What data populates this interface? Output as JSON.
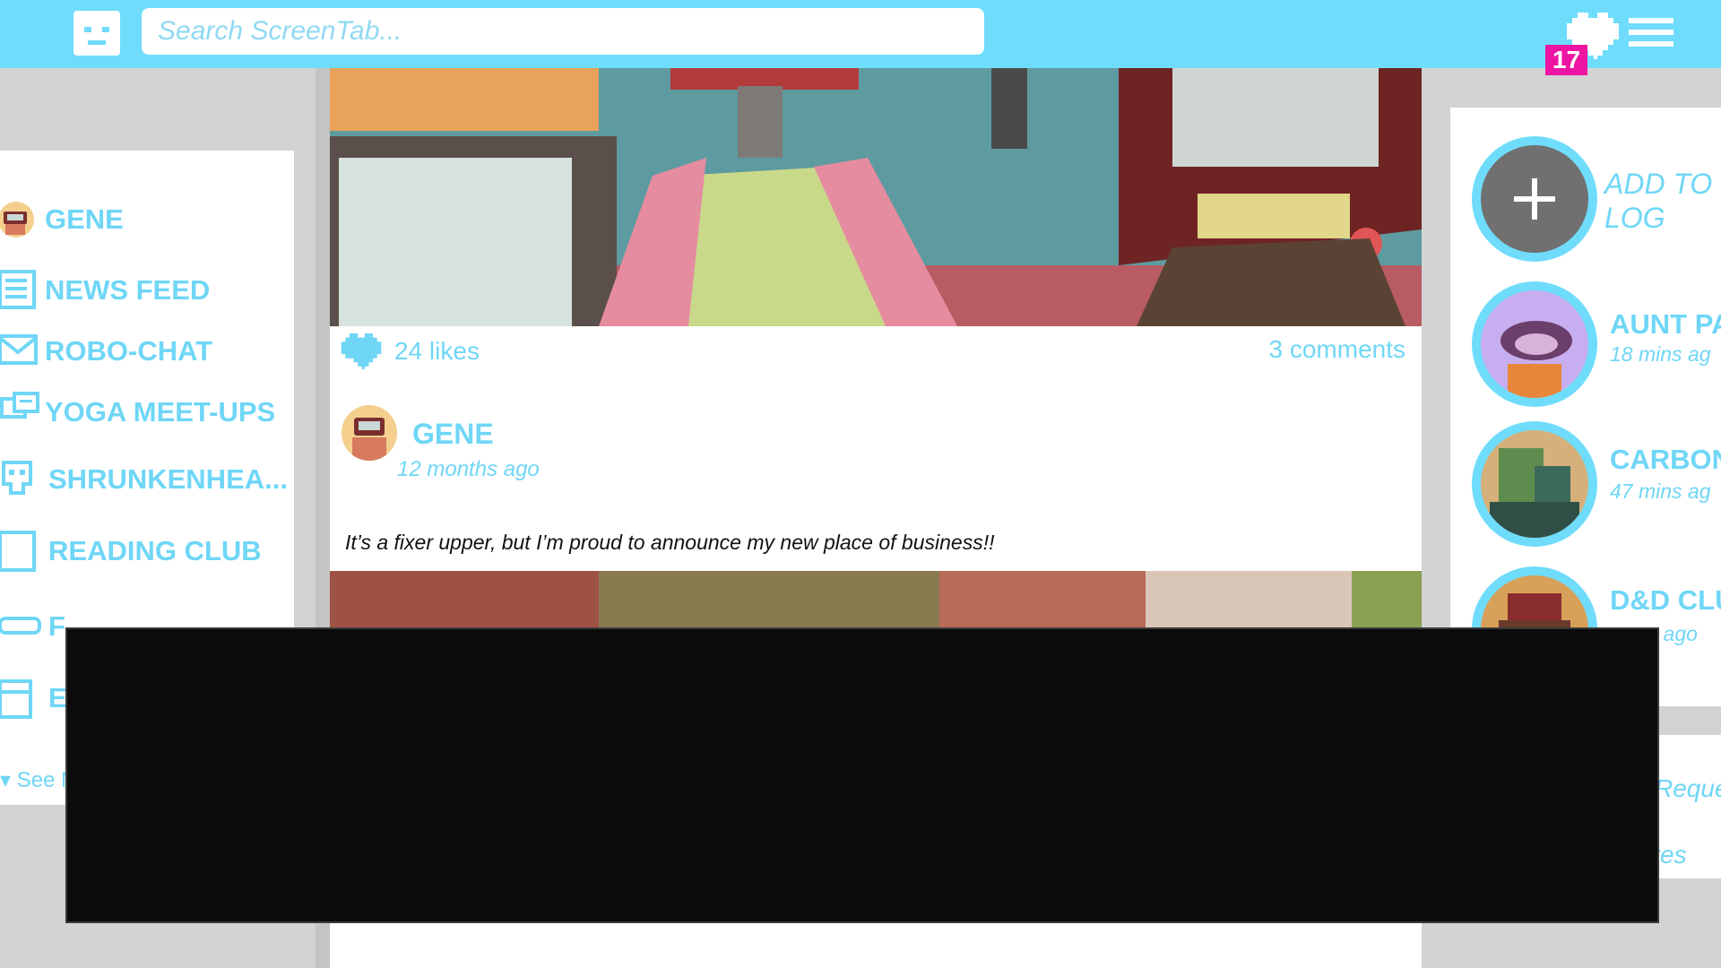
{
  "search": {
    "placeholder": "Search ScreenTab..."
  },
  "header": {
    "notification_count": "17"
  },
  "sidebar": {
    "items": [
      {
        "label": "GENE"
      },
      {
        "label": "NEWS FEED"
      },
      {
        "label": "ROBO-CHAT"
      },
      {
        "label": "YOGA MEET-UPS"
      },
      {
        "label": "SHRUNKENHEA..."
      },
      {
        "label": "READING CLUB"
      },
      {
        "label": "F"
      },
      {
        "label": "E"
      }
    ],
    "see_more": "See M"
  },
  "feed": {
    "post1": {
      "likes": "24 likes",
      "comments": "3 comments"
    },
    "post2": {
      "author": "GENE",
      "time": "12 months ago",
      "text": "It’s a fixer upper, but I’m proud to announce my new place of business!!"
    }
  },
  "right": {
    "add_label": "ADD TO LOG",
    "stories": [
      {
        "name": "AUNT PA",
        "time": "18 mins ag"
      },
      {
        "name": "CARBON",
        "time": "47 mins ag"
      },
      {
        "name": "D&D CLU",
        "time": "rs ago"
      }
    ],
    "links": [
      "Reque",
      "vites"
    ]
  },
  "colors": {
    "accent": "#6fdcfb",
    "badge": "#ee14a2"
  }
}
